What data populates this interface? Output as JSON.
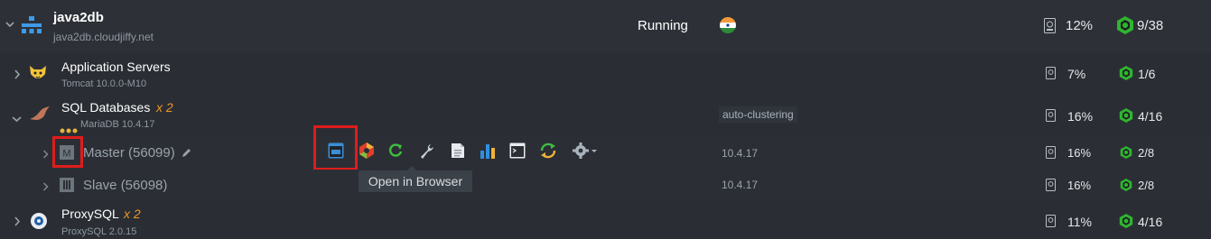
{
  "env": {
    "name": "java2db",
    "domain": "java2db.cloudjiffy.net",
    "status": "Running",
    "disk": "12%",
    "cloudlets": "9/38"
  },
  "nodes": [
    {
      "title": "Application Servers",
      "sub": "Tomcat 10.0.0-M10",
      "disk": "7%",
      "cloudlets": "1/6"
    },
    {
      "title": "SQL Databases",
      "multiplier": "x 2",
      "sub": "MariaDB 10.4.17",
      "tag": "auto-clustering",
      "disk": "16%",
      "cloudlets": "4/16"
    },
    {
      "title": "Master (56099)",
      "version": "10.4.17",
      "disk": "16%",
      "cloudlets": "2/8"
    },
    {
      "title": "Slave (56098)",
      "version": "10.4.17",
      "disk": "16%",
      "cloudlets": "2/8"
    },
    {
      "title": "ProxySQL",
      "multiplier": "x 2",
      "sub": "ProxySQL 2.0.15",
      "disk": "11%",
      "cloudlets": "4/16"
    }
  ],
  "tooltip": "Open in Browser",
  "icons": [
    "chevron-icon",
    "network-icon",
    "flag-icon",
    "disk-icon",
    "cloudlet-icon",
    "tomcat-icon",
    "mariadb-icon",
    "master-icon",
    "slave-icon",
    "pencil-icon",
    "open-browser-icon",
    "config-icon",
    "restart-icon",
    "wrench-icon",
    "log-icon",
    "stats-icon",
    "terminal-icon",
    "redeploy-icon",
    "gear-icon",
    "proxysql-icon"
  ],
  "colors": {
    "accent_green": "#2fb52f",
    "highlight_red": "#e01c1c",
    "multiplier_orange": "#f0962a"
  }
}
